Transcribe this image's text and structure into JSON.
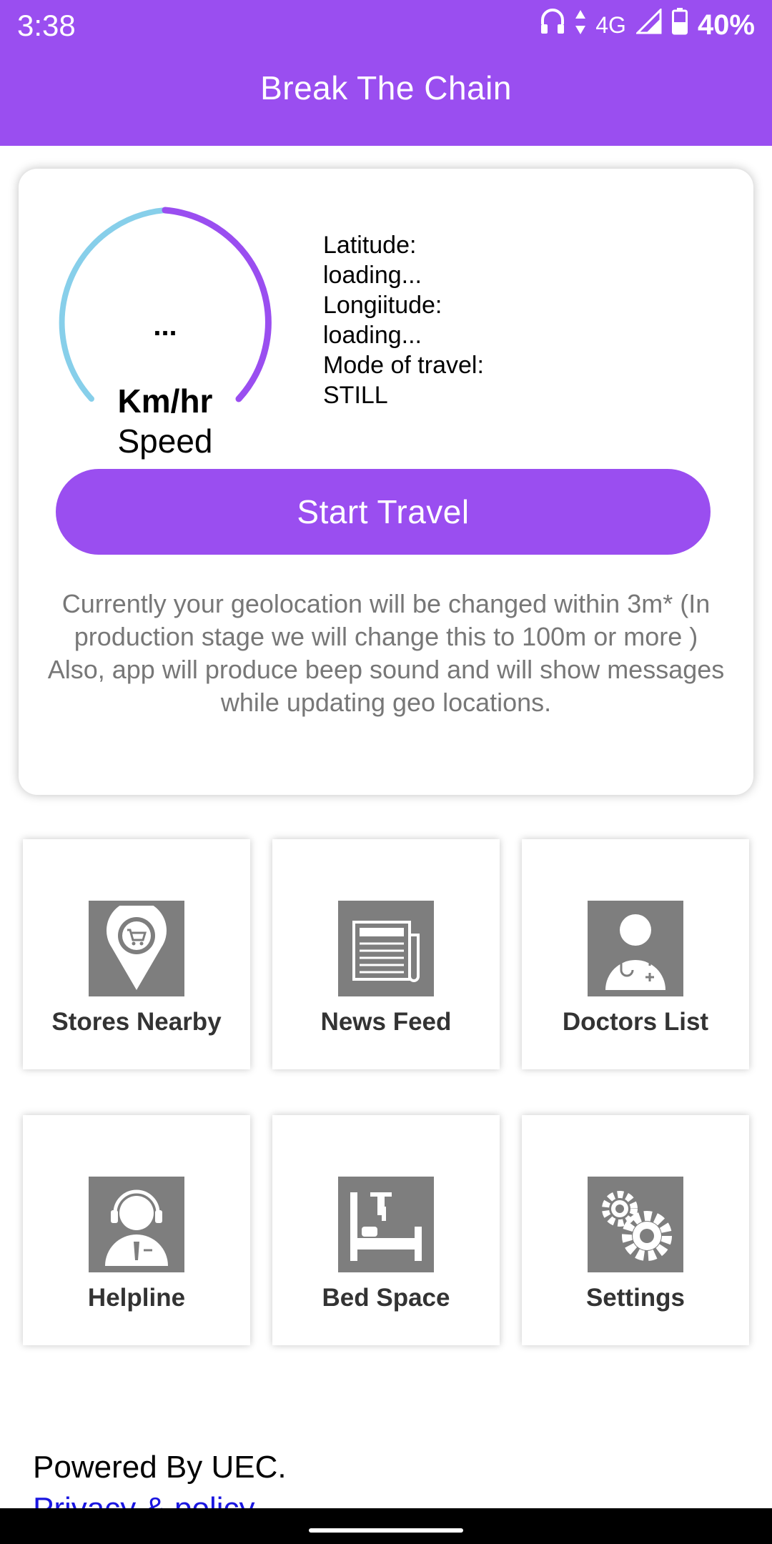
{
  "status_bar": {
    "time": "3:38",
    "network": "4G",
    "battery": "40%"
  },
  "app_bar": {
    "title": "Break The Chain"
  },
  "speed_card": {
    "speed_value": "...",
    "speed_unit": "Km/hr",
    "speed_label": "Speed",
    "latitude_label": "Latitude:",
    "latitude_value": "loading...",
    "longitude_label": "Longiitude:",
    "longitude_value": "loading...",
    "mode_label": "Mode of travel:",
    "mode_value": "STILL",
    "start_button": "Start Travel",
    "info_text": "Currently your geolocation will be changed within 3m* (In production stage we will change this to 100m or more )\nAlso, app will produce beep sound and will show messages while updating geo locations."
  },
  "tiles": [
    {
      "label": "Stores Nearby",
      "icon": "store-location-icon"
    },
    {
      "label": "News Feed",
      "icon": "newspaper-icon"
    },
    {
      "label": "Doctors List",
      "icon": "doctor-icon"
    },
    {
      "label": "Helpline",
      "icon": "headset-agent-icon"
    },
    {
      "label": "Bed Space",
      "icon": "hospital-bed-icon"
    },
    {
      "label": "Settings",
      "icon": "gears-icon"
    }
  ],
  "footer": {
    "powered_by": "Powered By UEC.",
    "privacy_link": "Privacy & policy"
  },
  "colors": {
    "primary": "#9a4ef0",
    "gauge_left": "#87cfea",
    "icon_gray": "#7e7e7e",
    "link": "#1a16e0"
  }
}
